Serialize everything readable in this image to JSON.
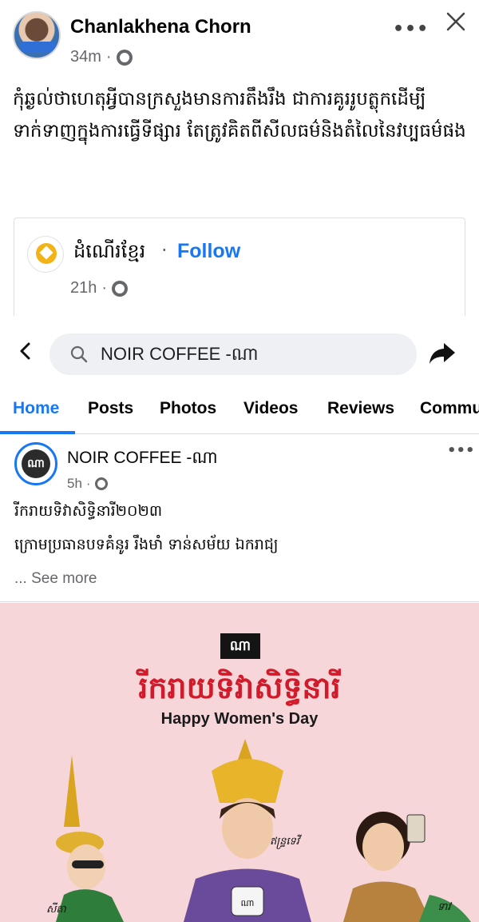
{
  "post": {
    "author": "Chanlakhena Chorn",
    "time": "34m",
    "separator": "·",
    "more": "•••",
    "text": "កុំឆ្ងល់ថាហេតុអ្វីបានក្រសួងមានការតឹងរឹង ជាការគូររូបត្លុកដើម្បីទាក់ទាញក្នុងការធ្វើទីផ្សារ តែត្រូវគិតពីសីលធម៌និងតំលៃនៃវប្បធម៌ផង"
  },
  "shared": {
    "page_name": "ដំណើរខ្មែរ",
    "separator": "·",
    "follow_label": "Follow",
    "time": "21h"
  },
  "screenshot": {
    "search_text": "NOIR COFFEE -ណា",
    "tabs": [
      "Home",
      "Posts",
      "Photos",
      "Videos",
      "Reviews",
      "Commu"
    ],
    "inner_post": {
      "author": "NOIR COFFEE -ណា",
      "avatar_mark": "ណា",
      "time": "5h",
      "separator": "·",
      "more": "•••",
      "line1": "រីករាយទិវាសិទ្ធិនារី២០២៣",
      "line2": "ក្រោមប្រធានបទគំនូរ រឹងមាំ ទាន់សម័យ ឯករាជ្យ",
      "see_more": "... See more"
    },
    "poster": {
      "logo": "ណា",
      "title": "រីករាយទិវាសិទ្ធិនារី",
      "subtitle": "Happy Women's Day",
      "labels": [
        "សីតា",
        "ឥន្ទ្រទេវី",
        "ទាវ"
      ],
      "cup_mark": "ណា"
    }
  },
  "colors": {
    "accent": "#1877f2",
    "poster_bg": "#f7d6da",
    "poster_title": "#d11a2a"
  }
}
